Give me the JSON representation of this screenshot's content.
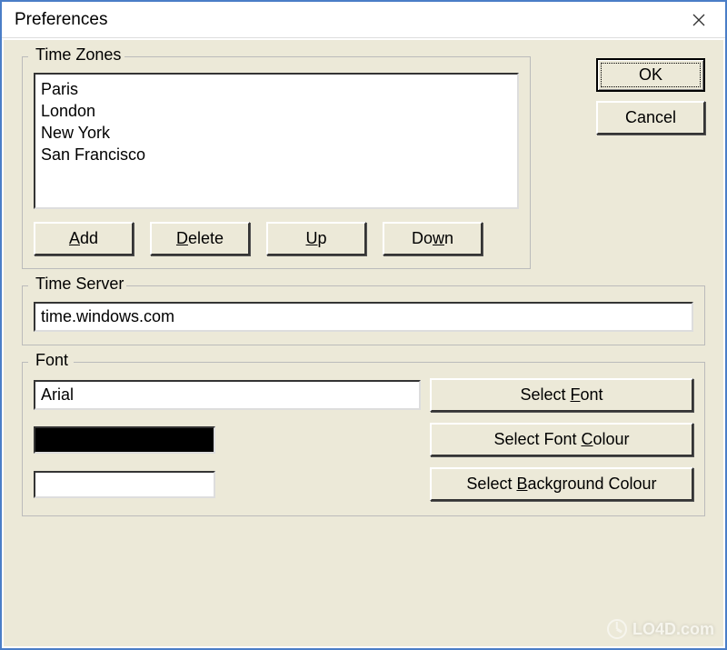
{
  "window": {
    "title": "Preferences"
  },
  "timezones": {
    "legend": "Time Zones",
    "items": [
      "Paris",
      "London",
      "New York",
      "San Francisco"
    ],
    "buttons": {
      "add": {
        "prefix": "",
        "u": "A",
        "suffix": "dd"
      },
      "delete": {
        "prefix": "",
        "u": "D",
        "suffix": "elete"
      },
      "up": {
        "prefix": "",
        "u": "U",
        "suffix": "p"
      },
      "down": {
        "prefix": "Do",
        "u": "w",
        "suffix": "n"
      }
    }
  },
  "timeserver": {
    "legend": "Time Server",
    "value": "time.windows.com"
  },
  "font": {
    "legend": "Font",
    "name": "Arial",
    "fontcolor": "#000000",
    "bgcolor": "#ffffff",
    "buttons": {
      "selectfont": {
        "prefix": "Select ",
        "u": "F",
        "suffix": "ont"
      },
      "selectfontcolour": {
        "prefix": "Select Font ",
        "u": "C",
        "suffix": "olour"
      },
      "selectbgcolour": {
        "prefix": "Select ",
        "u": "B",
        "suffix": "ackground Colour"
      }
    }
  },
  "dialog_buttons": {
    "ok": "OK",
    "cancel": "Cancel"
  },
  "watermark": "LO4D.com"
}
